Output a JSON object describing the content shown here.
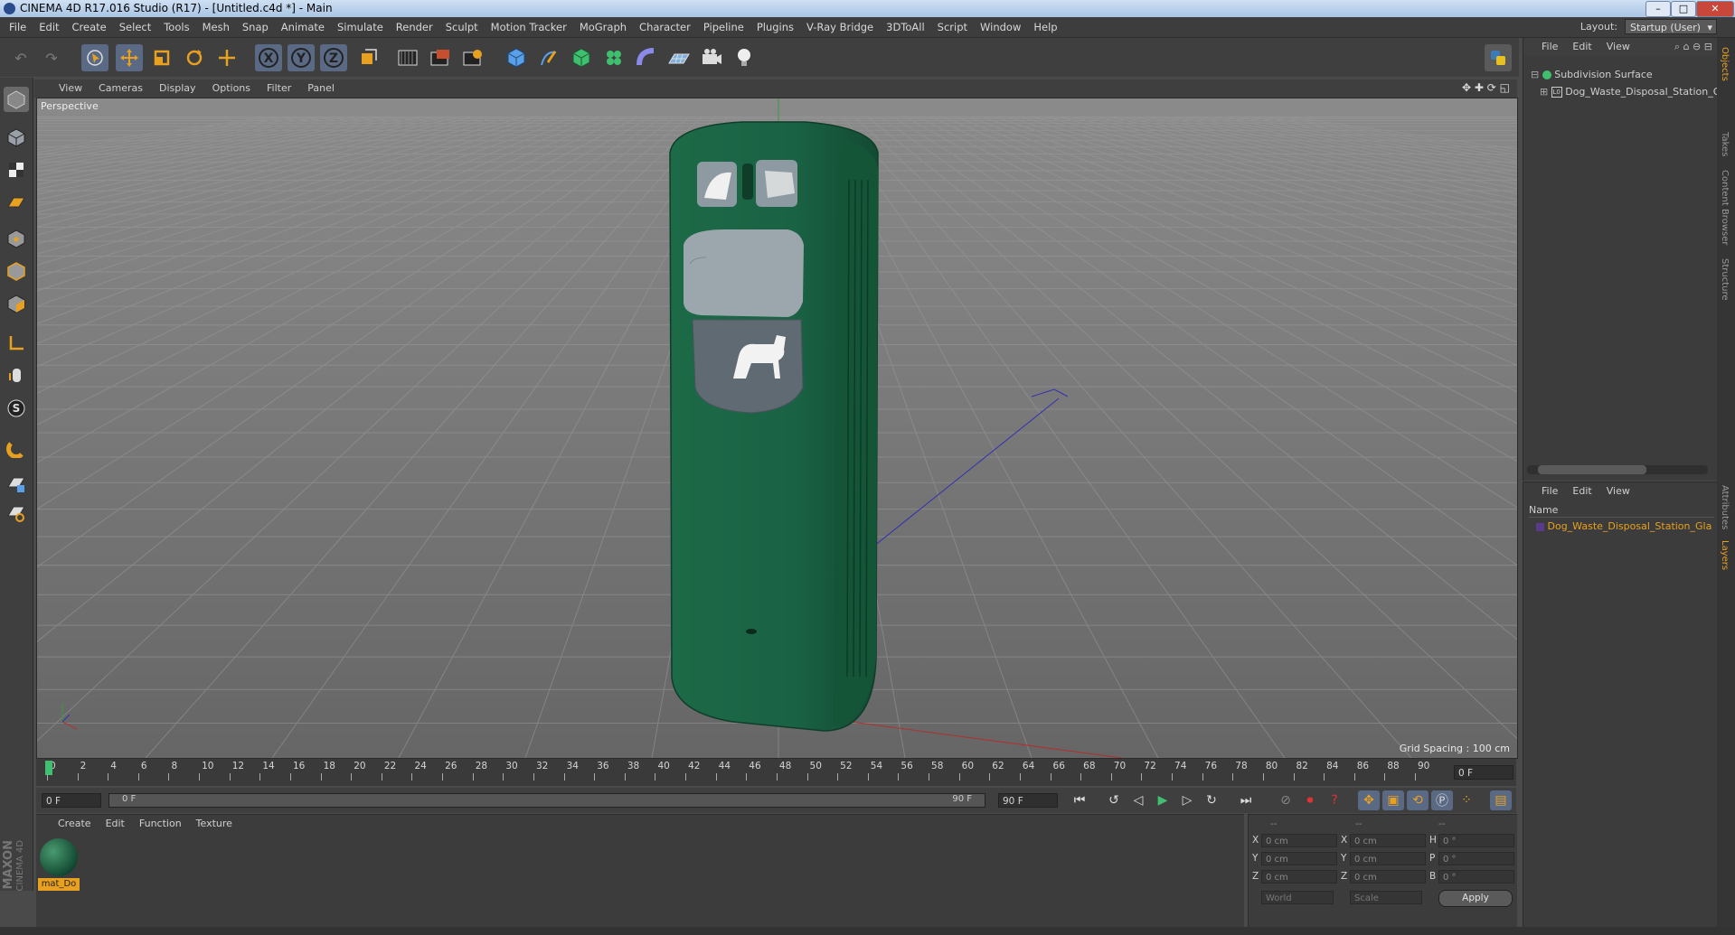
{
  "window": {
    "title": "CINEMA 4D R17.016 Studio (R17) - [Untitled.c4d *] - Main",
    "buttons": {
      "minimize": "–",
      "maximize": "□",
      "close": "✕"
    }
  },
  "menubar": {
    "items": [
      "File",
      "Edit",
      "Create",
      "Select",
      "Tools",
      "Mesh",
      "Snap",
      "Animate",
      "Simulate",
      "Render",
      "Sculpt",
      "Motion Tracker",
      "MoGraph",
      "Character",
      "Pipeline",
      "Plugins",
      "V-Ray Bridge",
      "3DToAll",
      "Script",
      "Window",
      "Help"
    ],
    "layout_label": "Layout:",
    "layout_value": "Startup (User)"
  },
  "toolbar": {
    "icons": [
      "undo-icon",
      "redo-icon",
      "live-selection-icon",
      "move-icon",
      "scale-icon",
      "rotate-icon",
      "recent-tool-icon",
      "x-axis-icon",
      "y-axis-icon",
      "z-axis-icon",
      "coordinate-system-icon",
      "render-view-icon",
      "render-picture-viewer-icon",
      "edit-render-settings-icon",
      "cube-icon",
      "pen-icon",
      "subdivision-icon",
      "cloner-icon",
      "deformer-icon",
      "floor-icon",
      "camera-icon",
      "light-icon"
    ],
    "axis_labels": [
      "X",
      "Y",
      "Z"
    ]
  },
  "viewport": {
    "menu": [
      "View",
      "Cameras",
      "Display",
      "Options",
      "Filter",
      "Panel"
    ],
    "label": "Perspective",
    "grid_spacing": "Grid Spacing : 100 cm"
  },
  "object_manager": {
    "menu": [
      "File",
      "Edit",
      "View"
    ],
    "objects": [
      {
        "name": "Subdivision Surface"
      },
      {
        "name": "Dog_Waste_Disposal_Station_Gl"
      }
    ]
  },
  "layer_manager": {
    "menu": [
      "File",
      "Edit",
      "View"
    ],
    "column": "Name",
    "layers": [
      "Dog_Waste_Disposal_Station_Gla"
    ]
  },
  "side_tabs": [
    "Objects",
    "Takes",
    "Content Browser",
    "Structure",
    "Attributes",
    "Layers"
  ],
  "timeline": {
    "ticks": [
      "0",
      "2",
      "4",
      "6",
      "8",
      "10",
      "12",
      "14",
      "16",
      "18",
      "20",
      "22",
      "24",
      "26",
      "28",
      "30",
      "32",
      "34",
      "36",
      "38",
      "40",
      "42",
      "44",
      "46",
      "48",
      "50",
      "52",
      "54",
      "56",
      "58",
      "60",
      "62",
      "64",
      "66",
      "68",
      "70",
      "72",
      "74",
      "76",
      "78",
      "80",
      "82",
      "84",
      "86",
      "88",
      "90"
    ],
    "current_frame": "0 F"
  },
  "playback": {
    "start": "0 F",
    "range_start": "0 F",
    "range_end": "90 F",
    "end": "90 F"
  },
  "material_manager": {
    "menu": [
      "Create",
      "Edit",
      "Function",
      "Texture"
    ],
    "materials": [
      {
        "name": "mat_Do"
      }
    ]
  },
  "coordinates": {
    "headers": [
      "--",
      "--",
      "--"
    ],
    "rows": [
      {
        "l1": "X",
        "v1": "0 cm",
        "l2": "X",
        "v2": "0 cm",
        "l3": "H",
        "v3": "0 °"
      },
      {
        "l1": "Y",
        "v1": "0 cm",
        "l2": "Y",
        "v2": "0 cm",
        "l3": "P",
        "v3": "0 °"
      },
      {
        "l1": "Z",
        "v1": "0 cm",
        "l2": "Z",
        "v2": "0 cm",
        "l3": "B",
        "v3": "0 °"
      }
    ],
    "mode1": "World",
    "mode2": "Scale",
    "apply": "Apply"
  },
  "brand": {
    "maxon": "MAXON",
    "cinema": "CINEMA 4D"
  },
  "colors": {
    "accent_orange": "#e8a020",
    "selection_blue": "#5a6a85",
    "station_green": "#1e6b4a"
  }
}
